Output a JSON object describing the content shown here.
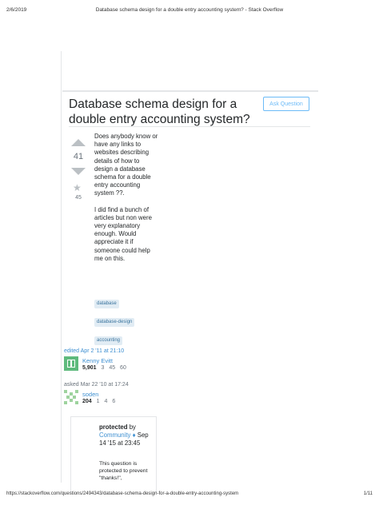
{
  "print_header": {
    "date": "2/6/2019",
    "title": "Database schema design for a double entry accounting system? - Stack Overflow"
  },
  "question": {
    "title": "Database schema design for a double entry accounting system?",
    "ask_button": "Ask Question",
    "votes": "41",
    "favorites": "45",
    "body": [
      "Does anybody know or have any links to websites describing details of how to design a database schema for a double entry accounting system ??.",
      "I did find a bunch of articles but non were very explanatory enough. Would appreciate it if someone could help me on this."
    ],
    "tags": [
      "database",
      "database-design",
      "accounting"
    ]
  },
  "editor": {
    "edited_text": "edited Apr 2 '11 at 21:10",
    "name": "Kenny Evitt",
    "reputation": "5,901",
    "badges": "3   45   60"
  },
  "asker": {
    "asked_text": "asked Mar 22 '10 at 17:24",
    "name": "soden",
    "reputation": "204",
    "badges": "1   4   6"
  },
  "protected_notice": {
    "label": "protected",
    "by": " by",
    "user": "Community",
    "diamond": " ♦",
    "when": "Sep 14 '15 at 23:45",
    "text": "This question is protected to prevent \"thanks!\","
  },
  "print_footer": {
    "url": "https://stackoverflow.com/questions/2494343/database-schema-design-for-a-double-entry-accounting-system",
    "page": "1/11"
  },
  "colors": {
    "link": "#3d8fd1",
    "tag_bg": "#e1ecf4",
    "tag_text": "#39739d",
    "vote_arrow": "#bbc0c4",
    "avatar_green": "#5eba7d"
  }
}
